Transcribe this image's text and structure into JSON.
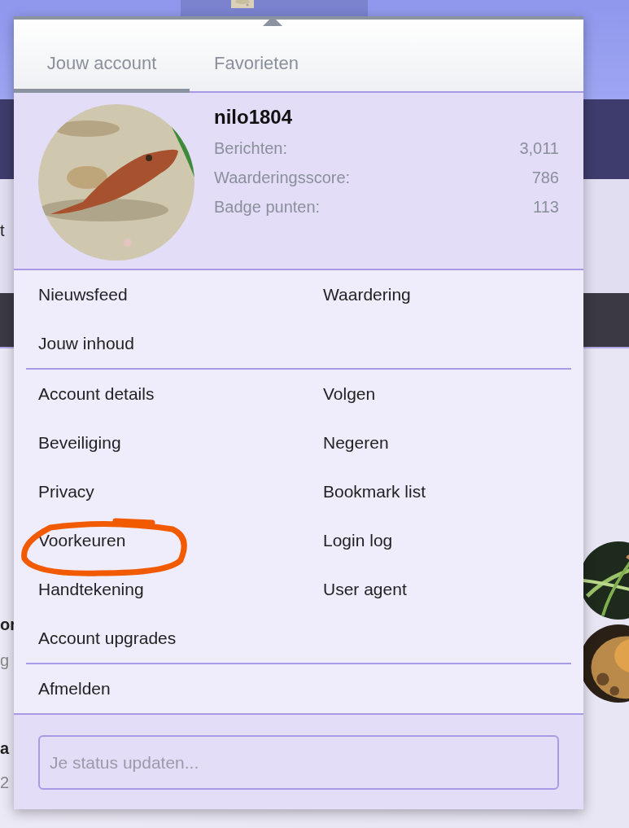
{
  "background": {
    "fragments": [
      {
        "text": "t",
        "kind": "plain"
      },
      {
        "text": "or",
        "kind": "bold"
      },
      {
        "text": "g",
        "kind": "muted"
      },
      {
        "text": "a",
        "kind": "bold"
      },
      {
        "text": "2",
        "kind": "muted"
      }
    ]
  },
  "tabs": [
    {
      "label": "Jouw account",
      "selected": true
    },
    {
      "label": "Favorieten",
      "selected": false
    }
  ],
  "profile": {
    "username": "nilo1804",
    "stats": [
      {
        "label": "Berichten:",
        "value": "3,011"
      },
      {
        "label": "Waarderingsscore:",
        "value": "786"
      },
      {
        "label": "Badge punten:",
        "value": "113"
      }
    ]
  },
  "menu_groups": [
    {
      "items": [
        {
          "label": "Nieuwsfeed",
          "circled": false
        },
        {
          "label": "Waardering",
          "circled": false
        },
        {
          "label": "Jouw inhoud",
          "circled": false
        }
      ]
    },
    {
      "items": [
        {
          "label": "Account details",
          "circled": false
        },
        {
          "label": "Volgen",
          "circled": false
        },
        {
          "label": "Beveiliging",
          "circled": false
        },
        {
          "label": "Negeren",
          "circled": false
        },
        {
          "label": "Privacy",
          "circled": false
        },
        {
          "label": "Bookmark list",
          "circled": false
        },
        {
          "label": "Voorkeuren",
          "circled": true
        },
        {
          "label": "Login log",
          "circled": false
        },
        {
          "label": "Handtekening",
          "circled": false
        },
        {
          "label": "User agent",
          "circled": false
        },
        {
          "label": "Account upgrades",
          "circled": false
        }
      ]
    },
    {
      "items": [
        {
          "label": "Afmelden",
          "circled": false
        }
      ]
    }
  ],
  "status": {
    "placeholder": "Je status updaten..."
  }
}
